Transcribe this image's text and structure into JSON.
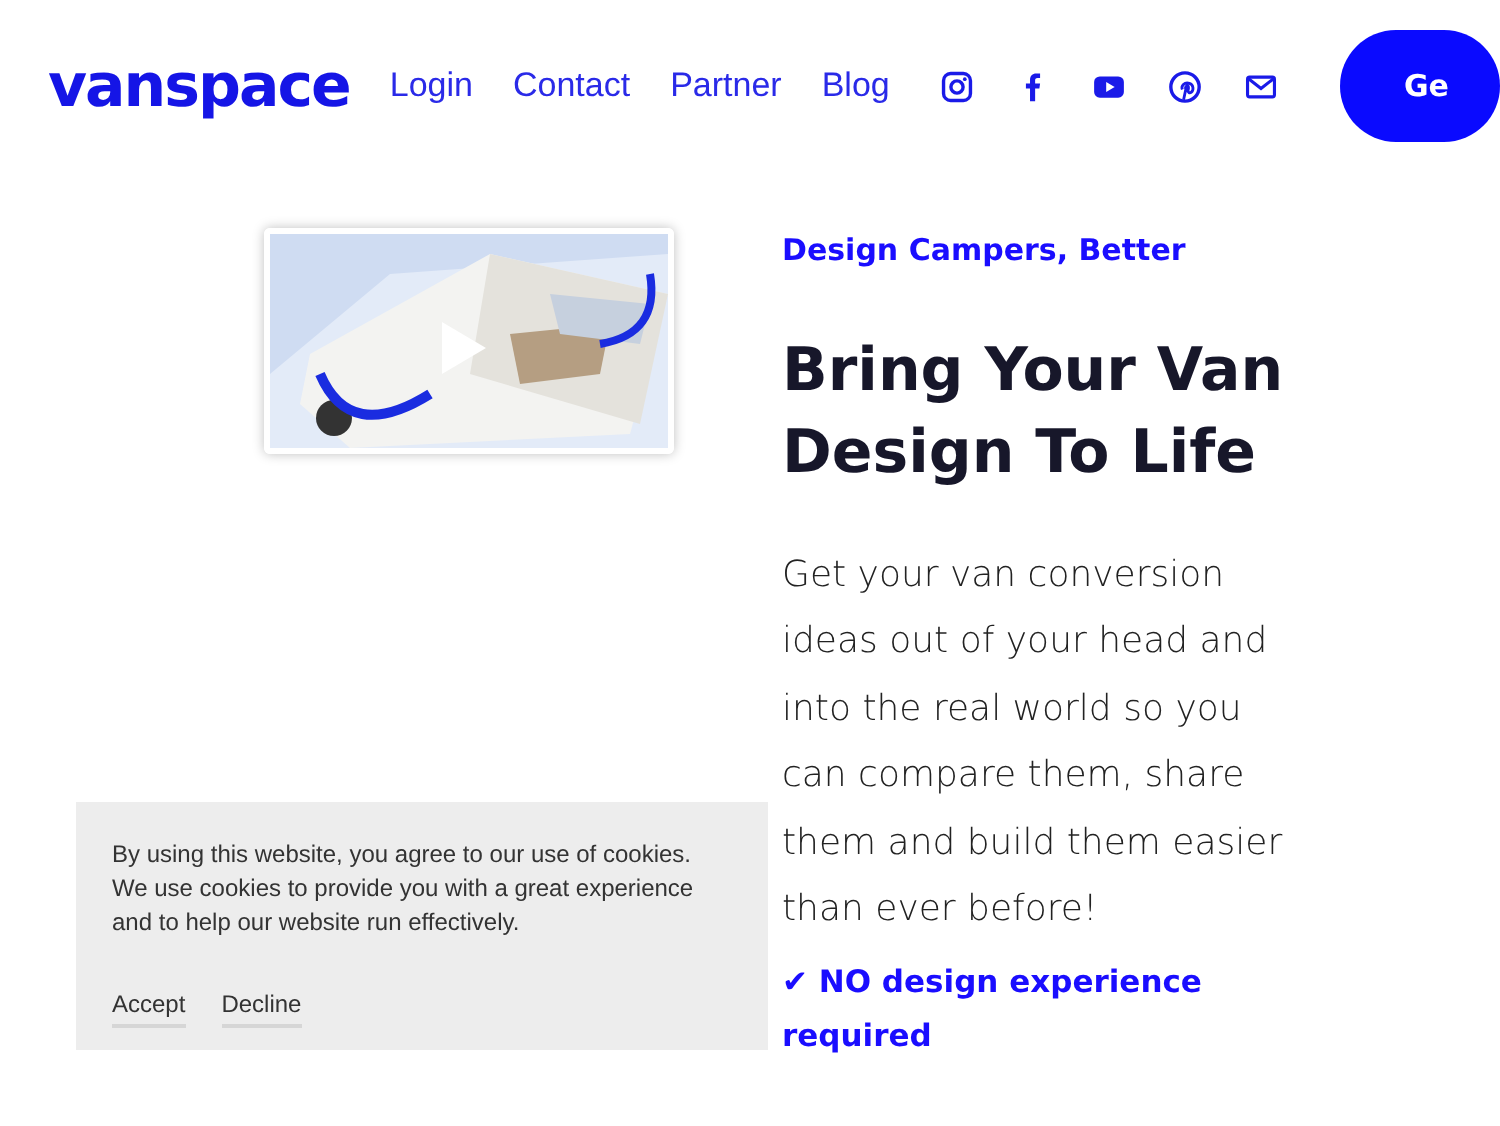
{
  "header": {
    "logo": "vanspace",
    "nav": [
      {
        "label": "Login"
      },
      {
        "label": "Contact"
      },
      {
        "label": "Partner"
      },
      {
        "label": "Blog"
      }
    ],
    "social": [
      {
        "kind": "instagram"
      },
      {
        "kind": "facebook"
      },
      {
        "kind": "youtube"
      },
      {
        "kind": "pinterest"
      },
      {
        "kind": "email"
      }
    ],
    "cta": "Ge"
  },
  "hero": {
    "eyebrow": "Design Campers, Better",
    "heading": "Bring Your Van Design To Life",
    "body": "Get your van conversion ideas out of your head and into the real world so you can compare them, share them and build them easier than ever before!",
    "feature": "✔ NO design experience required"
  },
  "cookie_banner": {
    "text": "By using this website, you agree to our use of cookies. We use cookies to provide you with a great experience and to help our website run effectively.",
    "actions": [
      {
        "label": "Accept"
      },
      {
        "label": "Decline"
      }
    ]
  }
}
